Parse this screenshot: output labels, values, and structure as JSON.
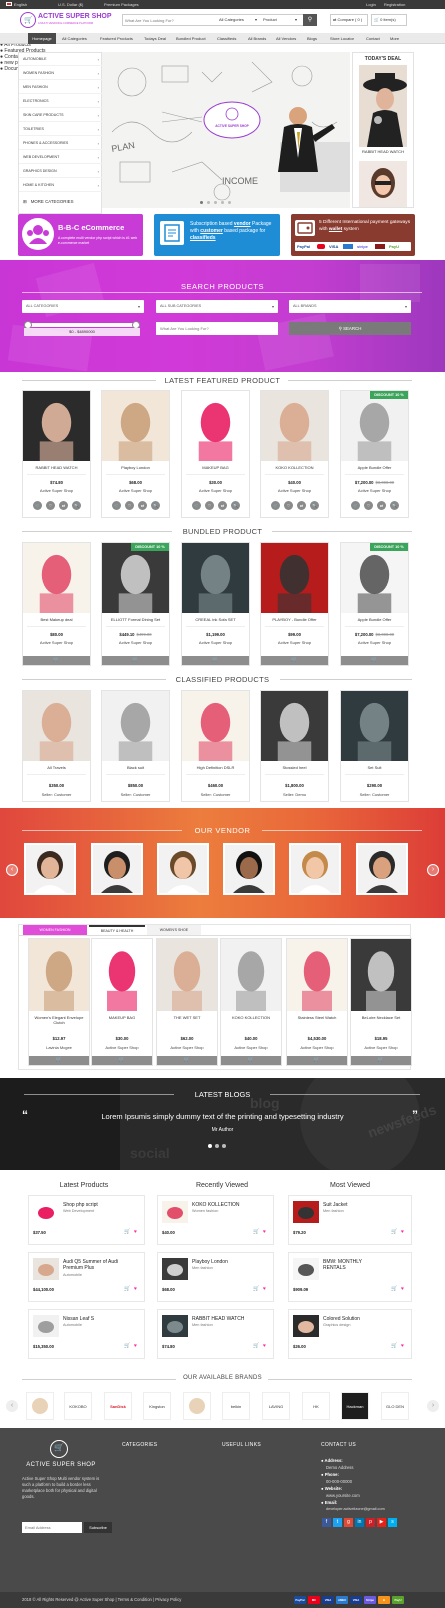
{
  "topbar": {
    "language": "English",
    "currency": "U.S. Dollar ($)",
    "premium": "Premium Packages",
    "login": "Login",
    "registration": "Registration"
  },
  "header": {
    "logo_title": "ACTIVE SUPER SHOP",
    "logo_tagline": "A MULTI VENDOR E-COMMERCE PLATFORM",
    "search_placeholder": "What Are You Looking For?",
    "category_select": "All Categories",
    "type_select": "Product",
    "compare": "Compare ( 0 )",
    "cart": "0 item(s)"
  },
  "nav": [
    "Homepage",
    "All Categories",
    "Featured Products",
    "Todays Deal",
    "Bundled Product",
    "Classifieds",
    "All Brands",
    "All Vendors",
    "Blogs",
    "Store Locator",
    "Contact",
    "More"
  ],
  "sidebar": {
    "items": [
      "AUTOMOBILE",
      "WOMEN FASHION",
      "MEN FASHION",
      "ELECTRONICS",
      "SKIN CARE PRODUCTS",
      "TOILETRIES",
      "PHONES & ACCESSORIES",
      "WEB DEVELOPMENT",
      "GRAPHICS DESIGN",
      "HOME & KITCHEN"
    ],
    "more": "MORE CATEGORIES"
  },
  "hero": {
    "badge": "ACTIVE SUPER SHOP"
  },
  "todays_deal": {
    "title": "TODAY'S DEAL",
    "item_name": "RABBIT HEAD WATCH"
  },
  "promos": {
    "p1_title": "B-B-C eCommerce",
    "p1_sub": "A complete multi vendor php script which is #1 web e-commerce market",
    "p2_text_1": "Subscription based",
    "p2_hl_1": "vendor",
    "p2_text_2": "Package with",
    "p2_hl_2": "customer",
    "p2_text_3": "based package for",
    "p2_hl_3": "classifieds",
    "p3_text": "5 Different International payment gateways with",
    "p3_hl": "wallet",
    "p3_tail": "system"
  },
  "search_products": {
    "title": "SEARCH PRODUCTS",
    "cat": "ALL CATEGORIES",
    "subcat": "ALL SUB CATEGORIES",
    "brands": "ALL BRANDS",
    "range": "$0 - $4890000",
    "placeholder": "What Are You Looking For?",
    "button": "SEARCH"
  },
  "featured": {
    "title": "LATEST FEATURED PRODUCT",
    "items": [
      {
        "name": "RABBIT HEAD WATCH",
        "price": "$74.80",
        "old": "",
        "shop": "Active Super Shop",
        "discount": ""
      },
      {
        "name": "Playboy London",
        "price": "$68.00",
        "old": "",
        "shop": "Active Super Shop",
        "discount": ""
      },
      {
        "name": "MAKEUP BAG",
        "price": "$30.00",
        "old": "",
        "shop": "Active Super Shop",
        "discount": ""
      },
      {
        "name": "KOKO KOLLECTION",
        "price": "$40.00",
        "old": "",
        "shop": "Active Super Shop",
        "discount": ""
      },
      {
        "name": "Apple Bundle Offer",
        "price": "$7,200.00",
        "old": "$8,000.00",
        "shop": "Active Super Shop",
        "discount": "DISCOUNT 10 %"
      }
    ]
  },
  "bundled": {
    "title": "BUNDLED PRODUCT",
    "items": [
      {
        "name": "Best Makeup deal",
        "price": "$80.00",
        "old": "",
        "shop": "Active Super Shop",
        "discount": ""
      },
      {
        "name": "ELLIOTT Formal Dining Set",
        "price": "$449.10",
        "old": "$499.00",
        "shop": "Active Super Shop",
        "discount": "DISCOUNT 10 %"
      },
      {
        "name": "CREEAL ink Sofa SET",
        "price": "$1,199.00",
        "old": "",
        "shop": "Active Super Shop",
        "discount": ""
      },
      {
        "name": "PLAYBOY - Bundle Offer",
        "price": "$99.00",
        "old": "",
        "shop": "Active Super Shop",
        "discount": ""
      },
      {
        "name": "Apple Bundle Offer",
        "price": "$7,200.00",
        "old": "$8,000.00",
        "shop": "Active Super Shop",
        "discount": "DISCOUNT 10 %"
      }
    ]
  },
  "classified": {
    "title": "CLASSIFIED PRODUCTS",
    "items": [
      {
        "name": "All Travels",
        "price": "$350.00",
        "shop": "Seller: Customer"
      },
      {
        "name": "Black suit",
        "price": "$850.00",
        "shop": "Seller: Customer"
      },
      {
        "name": "High Definition DSLR",
        "price": "$460.00",
        "shop": "Seller: Customer"
      },
      {
        "name": "Stossled heel",
        "price": "$1,800.00",
        "shop": "Seller: Demo"
      },
      {
        "name": "Set Suit",
        "price": "$290.00",
        "shop": "Seller: Customer"
      }
    ]
  },
  "vendors": {
    "title": "OUR VENDOR"
  },
  "tabs": {
    "labels": [
      "WOMEN FASHION",
      "BEAUTY & HEALTH",
      "WOMEN'S SHOE"
    ],
    "items": [
      {
        "name": "Women's Elegant Envelope Clutch",
        "price": "$12.97",
        "shop": "Lavinia Mcgee"
      },
      {
        "name": "MAKEUP BAG",
        "price": "$30.00",
        "shop": "Active Super Shop"
      },
      {
        "name": "THE WET SET",
        "price": "$62.00",
        "shop": "Active Super Shop"
      },
      {
        "name": "KOKO KOLLECTION",
        "price": "$40.00",
        "shop": "Active Super Shop"
      },
      {
        "name": "Stainless Steel Watch",
        "price": "$4,530.00",
        "shop": "Active Super Shop"
      },
      {
        "name": "BeLoire Necklace Set",
        "price": "$18.95",
        "shop": "Active Super Shop"
      }
    ]
  },
  "blogs": {
    "title": "LATEST BLOGS",
    "quote": "Lorem Ipsumis simply dummy text of the printing and typesetting industry",
    "author": "Mr Author"
  },
  "lists": {
    "latest": {
      "title": "Latest Products",
      "items": [
        {
          "name": "Shop php script",
          "cat": "Web Development",
          "price": "$37.50"
        },
        {
          "name": "Audi Q5 Summer of Audi Premium Plus",
          "cat": "Automobile",
          "price": "$44,100.00"
        },
        {
          "name": "Nissan Leaf S",
          "cat": "Automobile",
          "price": "$15,350.00"
        }
      ]
    },
    "viewed": {
      "title": "Recently Viewed",
      "items": [
        {
          "name": "KOKO KOLLECTION",
          "cat": "Women fashion",
          "price": "$40.00"
        },
        {
          "name": "Playboy London",
          "cat": "Men fashion",
          "price": "$68.00"
        },
        {
          "name": "RABBIT HEAD WATCH",
          "cat": "Men fashion",
          "price": "$74.80"
        }
      ]
    },
    "most": {
      "title": "Most Viewed",
      "items": [
        {
          "name": "Suit Jacket",
          "cat": "Men fashion",
          "price": "$79.20"
        },
        {
          "name": "BMW: MONTHLY RENTALS",
          "cat": "",
          "price": "$909.09"
        },
        {
          "name": "Colored Solution",
          "cat": "Graphics design",
          "price": "$26.00"
        }
      ]
    }
  },
  "brands": {
    "title": "OUR AVAILABLE BRANDS",
    "items": [
      "",
      "KOKOBO",
      "SanDisk",
      "Kingston",
      "",
      "belkin",
      "LAVING",
      "HK",
      "Hackman",
      "GLO DEN",
      ""
    ]
  },
  "footer": {
    "logo": "ACTIVE SUPER SHOP",
    "about": "Active Super Shop Multi vendor system is such a platform to build a border less marketplace both for physical and digital goods.",
    "email_placeholder": "Email Address",
    "subscribe": "Subscribe",
    "categories_title": "CATEGORIES",
    "categories": [
      "Automobile",
      "Women fashion",
      "Men fashion",
      "Electronics",
      "Skin Care Products",
      "Web Development"
    ],
    "links_title": "USEFUL LINKS",
    "links": [
      "Home",
      "All Products",
      "Featured Products",
      "Contact",
      "new page1",
      "Documentation"
    ],
    "contact_title": "CONTACT US",
    "address_label": "Address:",
    "address": "Demo Address",
    "phone_label": "Phone:",
    "phone": "00-000-00000",
    "website_label": "Website:",
    "website": "www.yoursite.com",
    "email_label": "Email:",
    "email": "developer.activeitzone@gmail.com",
    "copyright": "2018 © All Rights Reserved @ Active Super Shop | Terms & Condition | Privacy Policy",
    "payments": [
      "PayPal",
      "MC",
      "VISA",
      "AMEX",
      "VISA",
      "Stripe",
      "B",
      "PayU"
    ]
  },
  "colors": {
    "accent": "#c93bd6",
    "vendor_band": "#e45a3c",
    "discount": "#3ca55c",
    "pink": "#ff2aa6",
    "dark": "#4a4a4a"
  }
}
